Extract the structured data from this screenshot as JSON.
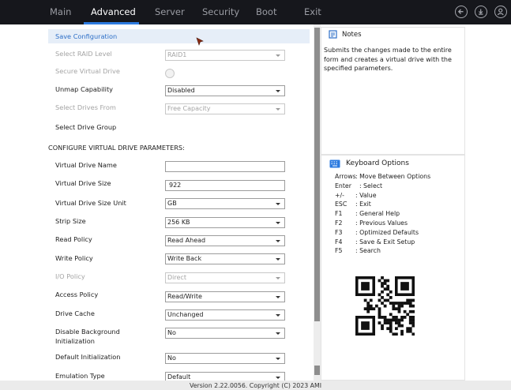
{
  "nav": {
    "tabs": [
      {
        "label": "Main"
      },
      {
        "label": "Advanced"
      },
      {
        "label": "Server"
      },
      {
        "label": "Security"
      },
      {
        "label": "Boot"
      },
      {
        "label": "Exit"
      }
    ],
    "active_tab": "Advanced",
    "icons": [
      "back-icon",
      "save-icon",
      "user-icon"
    ]
  },
  "form": {
    "save_config": "Save Configuration",
    "raid_level": {
      "label": "Select RAID Level",
      "value": "RAID1"
    },
    "secure_vd": {
      "label": "Secure Virtual Drive"
    },
    "unmap": {
      "label": "Unmap Capability",
      "value": "Disabled"
    },
    "drives_from": {
      "label": "Select Drives From",
      "value": "Free Capacity"
    },
    "drive_group": {
      "label": "Select Drive Group"
    },
    "section_title": "CONFIGURE VIRTUAL DRIVE PARAMETERS:",
    "vd_name": {
      "label": "Virtual Drive Name",
      "value": ""
    },
    "vd_size": {
      "label": "Virtual Drive Size",
      "value": "922"
    },
    "vd_unit": {
      "label": "Virtual Drive Size Unit",
      "value": "GB"
    },
    "strip": {
      "label": "Strip Size",
      "value": "256 KB"
    },
    "read_policy": {
      "label": "Read Policy",
      "value": "Read Ahead"
    },
    "write_policy": {
      "label": "Write Policy",
      "value": "Write Back"
    },
    "io_policy": {
      "label": "I/O Policy",
      "value": "Direct"
    },
    "access_policy": {
      "label": "Access Policy",
      "value": "Read/Write"
    },
    "drive_cache": {
      "label": "Drive Cache",
      "value": "Unchanged"
    },
    "bgi": {
      "label_line1": "Disable Background",
      "label_line2": "Initialization",
      "value": "No"
    },
    "default_init": {
      "label": "Default Initialization",
      "value": "No"
    },
    "emulation": {
      "label": "Emulation Type",
      "value": "Default"
    }
  },
  "notes": {
    "title": "Notes",
    "text": "Submits the changes made to the entire form and creates a virtual drive with the specified parameters."
  },
  "keyboard": {
    "title": "Keyboard Options",
    "items": [
      {
        "key": "Arrows",
        "desc": ": Move Between Options"
      },
      {
        "key": "Enter",
        "desc": "  : Select"
      },
      {
        "key": "+/-",
        "desc": ": Value"
      },
      {
        "key": "ESC",
        "desc": ": Exit"
      },
      {
        "key": "F1",
        "desc": ": General Help"
      },
      {
        "key": "F2",
        "desc": ": Previous Values"
      },
      {
        "key": "F3",
        "desc": ": Optimized Defaults"
      },
      {
        "key": "F4",
        "desc": ": Save & Exit Setup"
      },
      {
        "key": "F5",
        "desc": ": Search"
      }
    ]
  },
  "footer": {
    "text": "Version 2.22.0056. Copyright (C) 2023 AMI"
  },
  "colors": {
    "topbar": "#16171c",
    "accent": "#2d7be0",
    "link": "#2d6fc7",
    "highlight": "#e6eef8"
  }
}
